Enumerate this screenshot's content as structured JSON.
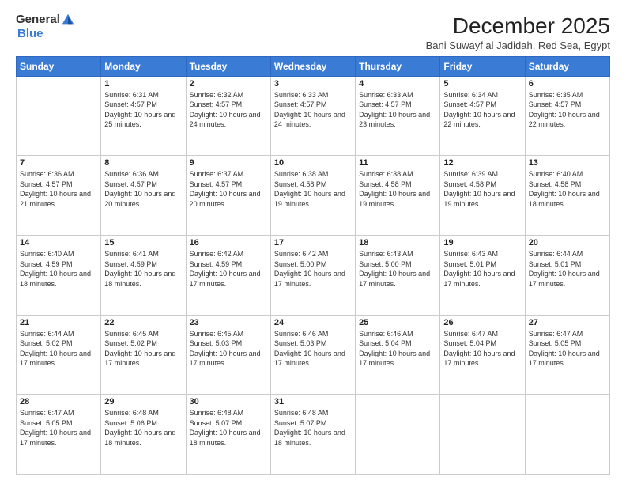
{
  "logo": {
    "general": "General",
    "blue": "Blue"
  },
  "title": "December 2025",
  "subtitle": "Bani Suwayf al Jadidah, Red Sea, Egypt",
  "days_header": [
    "Sunday",
    "Monday",
    "Tuesday",
    "Wednesday",
    "Thursday",
    "Friday",
    "Saturday"
  ],
  "weeks": [
    [
      {
        "day": "",
        "info": ""
      },
      {
        "day": "1",
        "info": "Sunrise: 6:31 AM\nSunset: 4:57 PM\nDaylight: 10 hours and 25 minutes."
      },
      {
        "day": "2",
        "info": "Sunrise: 6:32 AM\nSunset: 4:57 PM\nDaylight: 10 hours and 24 minutes."
      },
      {
        "day": "3",
        "info": "Sunrise: 6:33 AM\nSunset: 4:57 PM\nDaylight: 10 hours and 24 minutes."
      },
      {
        "day": "4",
        "info": "Sunrise: 6:33 AM\nSunset: 4:57 PM\nDaylight: 10 hours and 23 minutes."
      },
      {
        "day": "5",
        "info": "Sunrise: 6:34 AM\nSunset: 4:57 PM\nDaylight: 10 hours and 22 minutes."
      },
      {
        "day": "6",
        "info": "Sunrise: 6:35 AM\nSunset: 4:57 PM\nDaylight: 10 hours and 22 minutes."
      }
    ],
    [
      {
        "day": "7",
        "info": "Sunrise: 6:36 AM\nSunset: 4:57 PM\nDaylight: 10 hours and 21 minutes."
      },
      {
        "day": "8",
        "info": "Sunrise: 6:36 AM\nSunset: 4:57 PM\nDaylight: 10 hours and 20 minutes."
      },
      {
        "day": "9",
        "info": "Sunrise: 6:37 AM\nSunset: 4:57 PM\nDaylight: 10 hours and 20 minutes."
      },
      {
        "day": "10",
        "info": "Sunrise: 6:38 AM\nSunset: 4:58 PM\nDaylight: 10 hours and 19 minutes."
      },
      {
        "day": "11",
        "info": "Sunrise: 6:38 AM\nSunset: 4:58 PM\nDaylight: 10 hours and 19 minutes."
      },
      {
        "day": "12",
        "info": "Sunrise: 6:39 AM\nSunset: 4:58 PM\nDaylight: 10 hours and 19 minutes."
      },
      {
        "day": "13",
        "info": "Sunrise: 6:40 AM\nSunset: 4:58 PM\nDaylight: 10 hours and 18 minutes."
      }
    ],
    [
      {
        "day": "14",
        "info": "Sunrise: 6:40 AM\nSunset: 4:59 PM\nDaylight: 10 hours and 18 minutes."
      },
      {
        "day": "15",
        "info": "Sunrise: 6:41 AM\nSunset: 4:59 PM\nDaylight: 10 hours and 18 minutes."
      },
      {
        "day": "16",
        "info": "Sunrise: 6:42 AM\nSunset: 4:59 PM\nDaylight: 10 hours and 17 minutes."
      },
      {
        "day": "17",
        "info": "Sunrise: 6:42 AM\nSunset: 5:00 PM\nDaylight: 10 hours and 17 minutes."
      },
      {
        "day": "18",
        "info": "Sunrise: 6:43 AM\nSunset: 5:00 PM\nDaylight: 10 hours and 17 minutes."
      },
      {
        "day": "19",
        "info": "Sunrise: 6:43 AM\nSunset: 5:01 PM\nDaylight: 10 hours and 17 minutes."
      },
      {
        "day": "20",
        "info": "Sunrise: 6:44 AM\nSunset: 5:01 PM\nDaylight: 10 hours and 17 minutes."
      }
    ],
    [
      {
        "day": "21",
        "info": "Sunrise: 6:44 AM\nSunset: 5:02 PM\nDaylight: 10 hours and 17 minutes."
      },
      {
        "day": "22",
        "info": "Sunrise: 6:45 AM\nSunset: 5:02 PM\nDaylight: 10 hours and 17 minutes."
      },
      {
        "day": "23",
        "info": "Sunrise: 6:45 AM\nSunset: 5:03 PM\nDaylight: 10 hours and 17 minutes."
      },
      {
        "day": "24",
        "info": "Sunrise: 6:46 AM\nSunset: 5:03 PM\nDaylight: 10 hours and 17 minutes."
      },
      {
        "day": "25",
        "info": "Sunrise: 6:46 AM\nSunset: 5:04 PM\nDaylight: 10 hours and 17 minutes."
      },
      {
        "day": "26",
        "info": "Sunrise: 6:47 AM\nSunset: 5:04 PM\nDaylight: 10 hours and 17 minutes."
      },
      {
        "day": "27",
        "info": "Sunrise: 6:47 AM\nSunset: 5:05 PM\nDaylight: 10 hours and 17 minutes."
      }
    ],
    [
      {
        "day": "28",
        "info": "Sunrise: 6:47 AM\nSunset: 5:05 PM\nDaylight: 10 hours and 17 minutes."
      },
      {
        "day": "29",
        "info": "Sunrise: 6:48 AM\nSunset: 5:06 PM\nDaylight: 10 hours and 18 minutes."
      },
      {
        "day": "30",
        "info": "Sunrise: 6:48 AM\nSunset: 5:07 PM\nDaylight: 10 hours and 18 minutes."
      },
      {
        "day": "31",
        "info": "Sunrise: 6:48 AM\nSunset: 5:07 PM\nDaylight: 10 hours and 18 minutes."
      },
      {
        "day": "",
        "info": ""
      },
      {
        "day": "",
        "info": ""
      },
      {
        "day": "",
        "info": ""
      }
    ]
  ]
}
